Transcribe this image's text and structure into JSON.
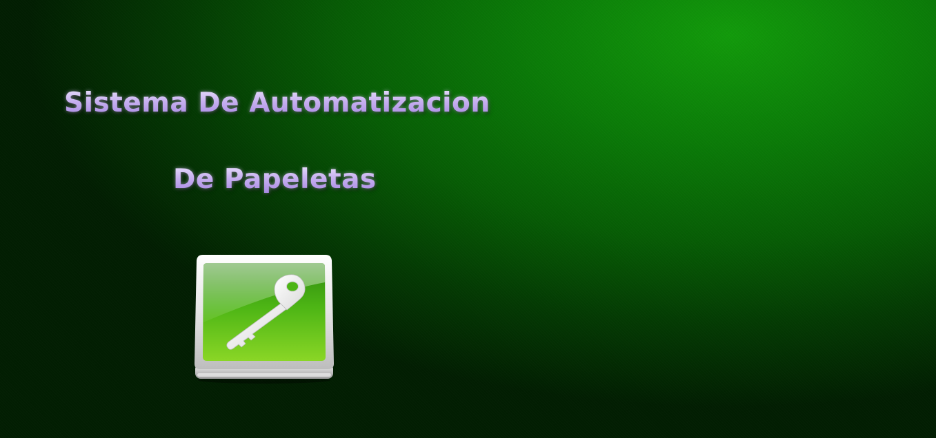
{
  "slide": {
    "title_line_1": "Sistema De Automatizacion",
    "title_line_2": "De Papeletas",
    "icon": "key-icon"
  },
  "colors": {
    "background_light": "#129a0b",
    "background_dark": "#021e02",
    "title_text": "#c9b3f2",
    "icon_green": "#5cc21a"
  }
}
